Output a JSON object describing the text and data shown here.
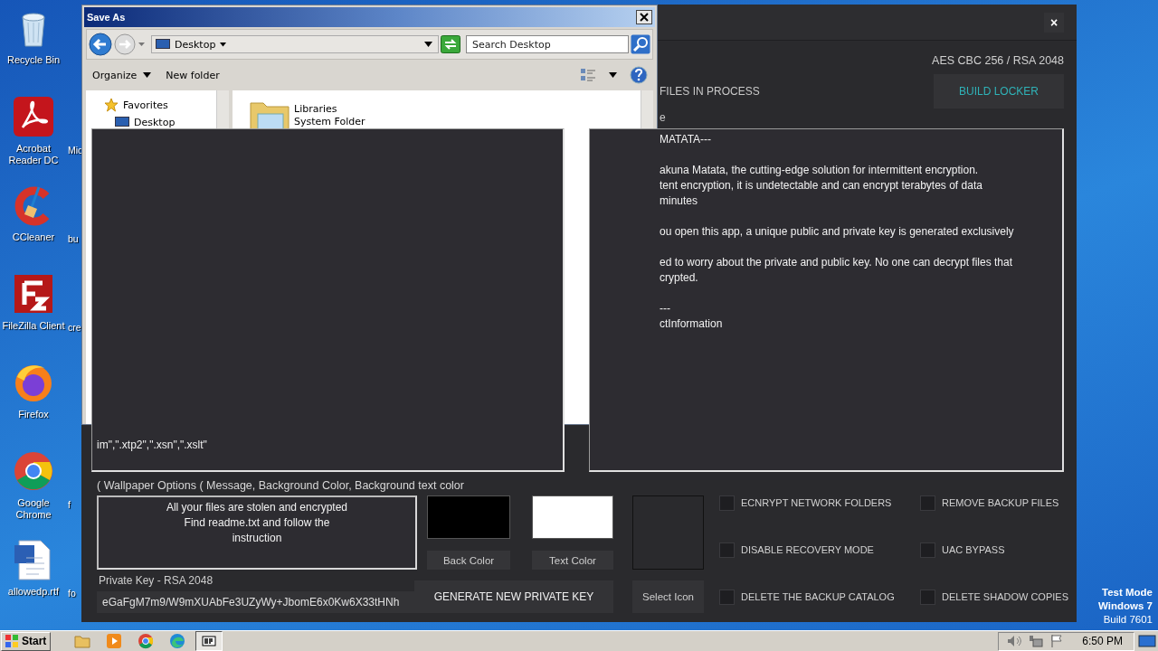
{
  "desktop": {
    "rows": [
      {
        "icons": [
          {
            "kind": "recycle",
            "label": "Recycle Bin"
          }
        ]
      },
      {
        "icons": [
          {
            "kind": "acrobat",
            "label": "Acrobat Reader DC"
          },
          {
            "kind": "cut",
            "label": "Mic"
          }
        ]
      },
      {
        "icons": [
          {
            "kind": "ccleaner",
            "label": "CCleaner"
          },
          {
            "kind": "cut",
            "label": "bu"
          }
        ]
      },
      {
        "icons": [
          {
            "kind": "filezilla",
            "label": "FileZilla Client"
          },
          {
            "kind": "cut",
            "label": "cre"
          }
        ]
      },
      {
        "icons": [
          {
            "kind": "firefox",
            "label": "Firefox"
          }
        ]
      },
      {
        "icons": [
          {
            "kind": "chrome",
            "label": "Google Chrome"
          },
          {
            "kind": "cut",
            "label": "f"
          }
        ]
      },
      {
        "icons": [
          {
            "kind": "document",
            "label": "allowedp.rtf"
          },
          {
            "kind": "cut",
            "label": "fo"
          }
        ]
      }
    ]
  },
  "locker": {
    "close": "×",
    "cipher": "AES CBC 256 / RSA 2048",
    "build_button": "BUILD LOCKER",
    "labels": [
      "FILES IN PROCESS",
      "e"
    ],
    "extensions_panel": {
      "lines": [
        "im\",\".xtp2\",\".xsn\",\".xslt\""
      ]
    },
    "note_panel": {
      "paragraphs": [
        [
          "MATATA---"
        ],
        [
          "akuna Matata, the cutting-edge solution for intermittent encryption.",
          "tent encryption, it is undetectable and can encrypt terabytes of data",
          "minutes"
        ],
        [
          "ou open this app, a unique public and private key is generated exclusively"
        ],
        [
          "ed to worry about the private and public key. No one can decrypt files that",
          "crypted."
        ],
        [
          "---",
          "ctInformation"
        ]
      ]
    },
    "wallpaper": {
      "heading": "( Wallpaper Options ( Message, Background Color, Background text color",
      "message": [
        "All your files are stolen and encrypted",
        "Find readme.txt and follow the",
        "instruction"
      ],
      "swatches": [
        {
          "color": "#000000",
          "button": "Back Color"
        },
        {
          "color": "#ffffff",
          "button": "Text Color"
        }
      ]
    },
    "private_key": {
      "label": "Private Key - RSA 2048",
      "value": "eGaFgM7m9/W9mXUAbFe3UZyWy+JbomE6x0Kw6X33tHNh",
      "generate_button": "GENERATE NEW PRIVATE KEY"
    },
    "icon": {
      "button": "Select Icon"
    },
    "options": [
      {
        "label": "ECNRYPT NETWORK FOLDERS",
        "checked": false
      },
      {
        "label": "REMOVE BACKUP FILES",
        "checked": false
      },
      {
        "label": "DISABLE RECOVERY MODE",
        "checked": false
      },
      {
        "label": "UAC BYPASS",
        "checked": false
      },
      {
        "label": "DELETE THE BACKUP CATALOG",
        "checked": false
      },
      {
        "label": "DELETE SHADOW COPIES",
        "checked": false
      }
    ]
  },
  "save_dialog": {
    "title": "Save As",
    "location": "Desktop",
    "search": {
      "placeholder": "Search Desktop"
    },
    "toolbar": [
      "Organize",
      "New folder"
    ],
    "navigation": [
      {
        "kind": "favorites",
        "label": "Favorites"
      },
      {
        "kind": "desktop",
        "label": "Desktop"
      }
    ],
    "files": [
      {
        "name": "Libraries",
        "type": "System Folder"
      }
    ]
  },
  "os_notice": [
    {
      "text": "Test Mode",
      "emphasis": true
    },
    {
      "text": "Windows 7",
      "emphasis": true
    },
    {
      "text": "Build 7601",
      "emphasis": false
    }
  ],
  "taskbar": {
    "start": "Start",
    "apps": [
      {
        "kind": "explorer",
        "selected": false
      },
      {
        "kind": "media",
        "selected": false
      },
      {
        "kind": "chrome",
        "selected": false
      },
      {
        "kind": "edge",
        "selected": false
      },
      {
        "kind": "builder",
        "selected": true
      }
    ],
    "clock": "6:50 PM"
  }
}
